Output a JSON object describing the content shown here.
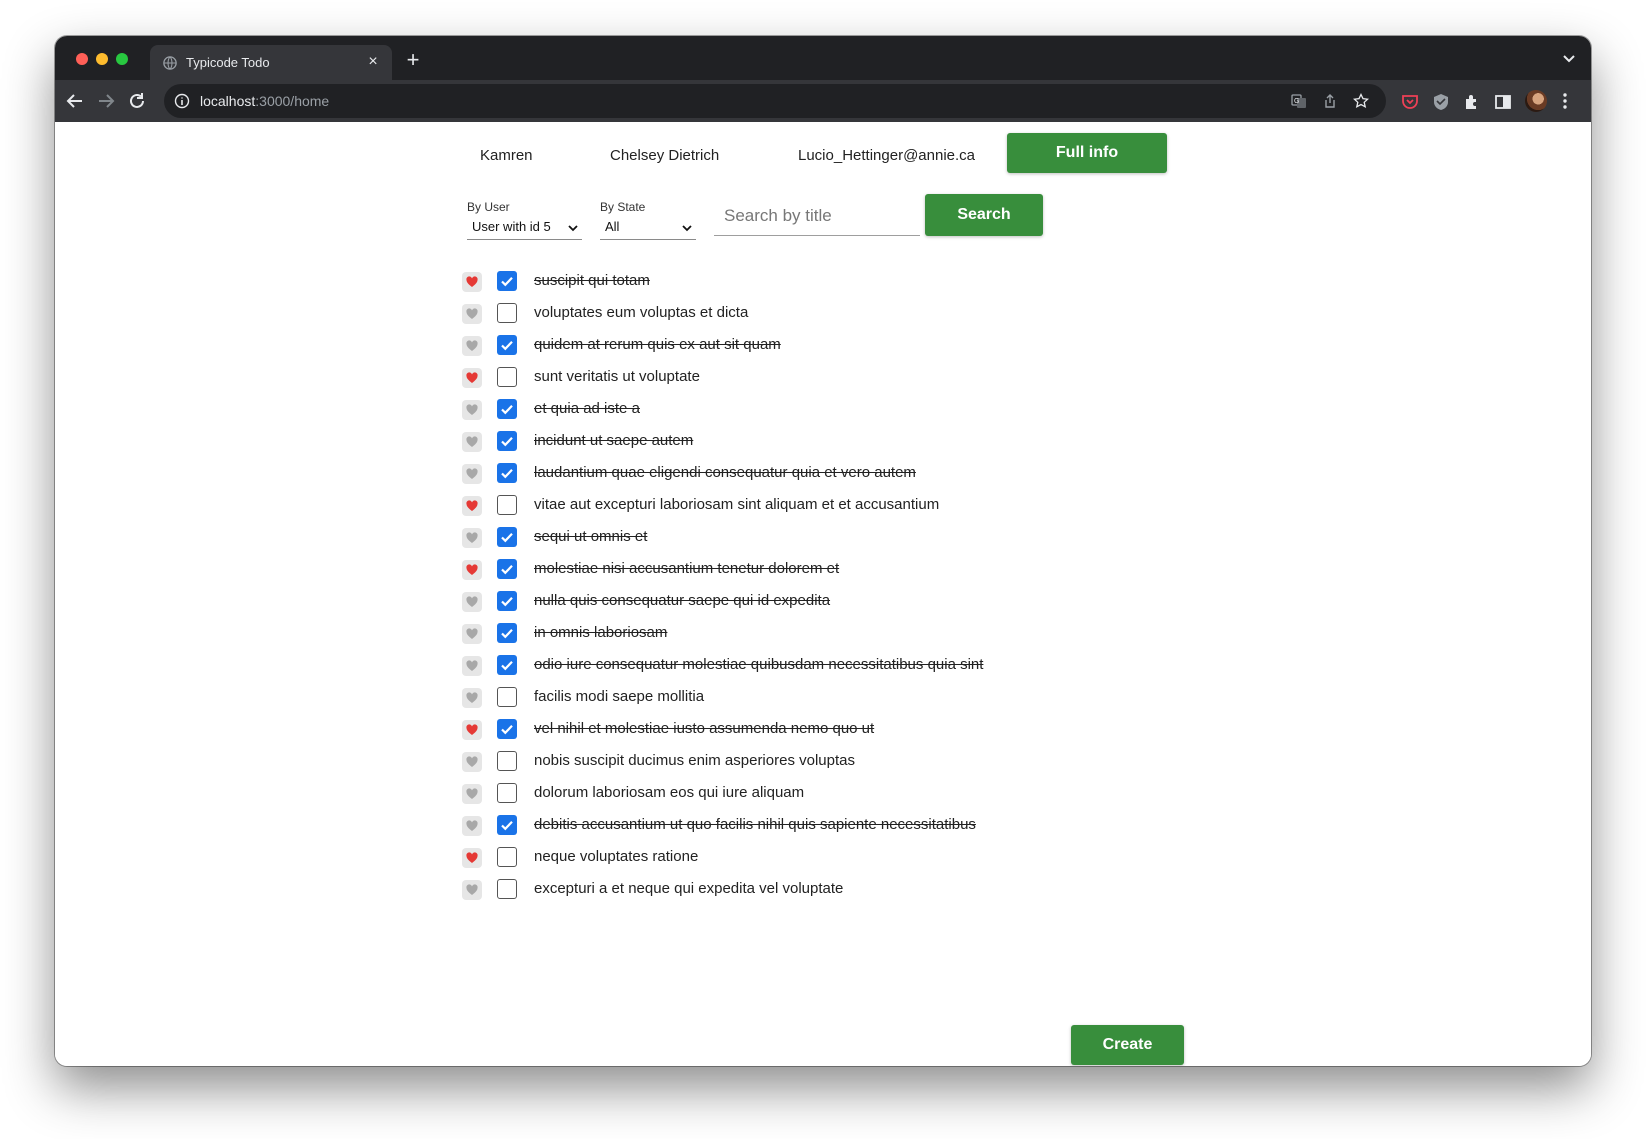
{
  "browser": {
    "tab_title": "Typicode Todo",
    "url_host": "localhost",
    "url_rest": ":3000/home",
    "new_tab_symbol": "+",
    "close_symbol": "×",
    "icons": [
      "back-icon",
      "forward-icon",
      "reload-icon",
      "site-info-icon",
      "translate-icon",
      "share-icon",
      "bookmark-star-icon",
      "pocket-icon",
      "shield-icon",
      "extensions-icon",
      "side-panel-icon",
      "profile-avatar",
      "chrome-menu-icon"
    ]
  },
  "user": {
    "username": "Kamren",
    "name": "Chelsey Dietrich",
    "email": "Lucio_Hettinger@annie.ca",
    "full_info_label": "Full info"
  },
  "filters": {
    "by_user_label": "By User",
    "by_user_value": "User with id 5",
    "by_state_label": "By State",
    "by_state_value": "All",
    "search_placeholder": "Search by title",
    "search_label": "Search"
  },
  "todos": [
    {
      "title": "suscipit qui totam",
      "completed": true,
      "favorite": true
    },
    {
      "title": "voluptates eum voluptas et dicta",
      "completed": false,
      "favorite": false
    },
    {
      "title": "quidem at rerum quis ex aut sit quam",
      "completed": true,
      "favorite": false
    },
    {
      "title": "sunt veritatis ut voluptate",
      "completed": false,
      "favorite": true
    },
    {
      "title": "et quia ad iste a",
      "completed": true,
      "favorite": false
    },
    {
      "title": "incidunt ut saepe autem",
      "completed": true,
      "favorite": false
    },
    {
      "title": "laudantium quae eligendi consequatur quia et vero autem",
      "completed": true,
      "favorite": false
    },
    {
      "title": "vitae aut excepturi laboriosam sint aliquam et et accusantium",
      "completed": false,
      "favorite": true
    },
    {
      "title": "sequi ut omnis et",
      "completed": true,
      "favorite": false
    },
    {
      "title": "molestiae nisi accusantium tenetur dolorem et",
      "completed": true,
      "favorite": true
    },
    {
      "title": "nulla quis consequatur saepe qui id expedita",
      "completed": true,
      "favorite": false
    },
    {
      "title": "in omnis laboriosam",
      "completed": true,
      "favorite": false
    },
    {
      "title": "odio iure consequatur molestiae quibusdam necessitatibus quia sint",
      "completed": true,
      "favorite": false
    },
    {
      "title": "facilis modi saepe mollitia",
      "completed": false,
      "favorite": false
    },
    {
      "title": "vel nihil et molestiae iusto assumenda nemo quo ut",
      "completed": true,
      "favorite": true
    },
    {
      "title": "nobis suscipit ducimus enim asperiores voluptas",
      "completed": false,
      "favorite": false
    },
    {
      "title": "dolorum laboriosam eos qui iure aliquam",
      "completed": false,
      "favorite": false
    },
    {
      "title": "debitis accusantium ut quo facilis nihil quis sapiente necessitatibus",
      "completed": true,
      "favorite": false
    },
    {
      "title": "neque voluptates ratione",
      "completed": false,
      "favorite": true
    },
    {
      "title": "excepturi a et neque qui expedita vel voluptate",
      "completed": false,
      "favorite": false
    }
  ],
  "create_label": "Create",
  "colors": {
    "accent_green": "#388e3c",
    "checkbox_blue": "#1a73e8",
    "heart_red": "#e53935",
    "heart_gray": "#a8a8a8"
  }
}
